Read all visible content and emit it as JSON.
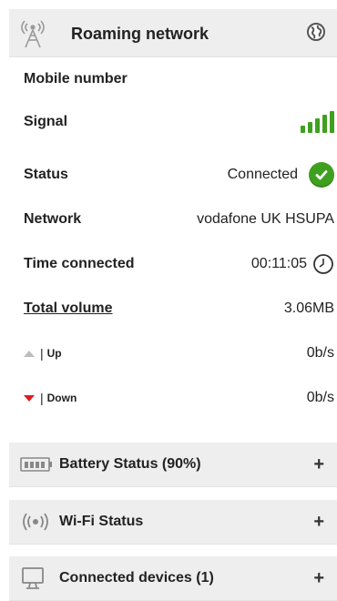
{
  "header": {
    "title": "Roaming network",
    "antenna_icon": "antenna-icon",
    "globe_icon": "globe-icon"
  },
  "rows": {
    "mobile_number": {
      "label": "Mobile number",
      "value": ""
    },
    "signal": {
      "label": "Signal",
      "bars": 5,
      "color": "#3fa020"
    },
    "status": {
      "label": "Status",
      "value": "Connected",
      "icon": "check-icon",
      "icon_color": "#3fa020"
    },
    "network": {
      "label": "Network",
      "value": "vodafone UK HSUPA"
    },
    "time_connected": {
      "label": "Time connected",
      "value": "00:11:05",
      "icon": "clock-icon"
    },
    "total_volume": {
      "label": "Total volume",
      "value": "3.06MB"
    },
    "up": {
      "label": "Up",
      "sep": "|",
      "value": "0b/s",
      "arrow_color": "#bdbdbd"
    },
    "down": {
      "label": "Down",
      "sep": "|",
      "value": "0b/s",
      "arrow_color": "#e21a1a"
    }
  },
  "sections": [
    {
      "label": "Battery Status (90%)",
      "icon": "battery-icon",
      "toggle": "+"
    },
    {
      "label": "Wi-Fi Status",
      "icon": "wifi-icon",
      "toggle": "+"
    },
    {
      "label": "Connected devices (1)",
      "icon": "monitor-icon",
      "toggle": "+"
    }
  ]
}
